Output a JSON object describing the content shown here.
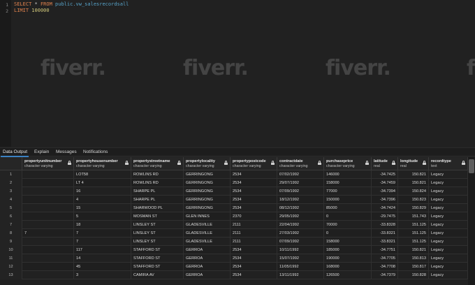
{
  "editor": {
    "line_numbers": [
      "1",
      "2"
    ],
    "line1": {
      "kw1": "SELECT",
      "star": " * ",
      "kw2": "FROM",
      "space": " ",
      "table": "public.vw_salesrecordsall"
    },
    "line2": {
      "kw": "LIMIT",
      "space": " ",
      "num": "100000"
    }
  },
  "watermark": "fiverr.",
  "tabs": [
    {
      "label": "Data Output",
      "active": true
    },
    {
      "label": "Explain",
      "active": false
    },
    {
      "label": "Messages",
      "active": false
    },
    {
      "label": "Notifications",
      "active": false
    }
  ],
  "columns": [
    {
      "name": "propertyunitnumber",
      "type": "character varying"
    },
    {
      "name": "propertyhousenumber",
      "type": "character varying"
    },
    {
      "name": "propertystreetname",
      "type": "character varying"
    },
    {
      "name": "propertylocality",
      "type": "character varying"
    },
    {
      "name": "propertypostcode",
      "type": "character varying"
    },
    {
      "name": "contractdate",
      "type": "character varying"
    },
    {
      "name": "purchaseprice",
      "type": "character varying"
    },
    {
      "name": "latitude",
      "type": "real"
    },
    {
      "name": "longitude",
      "type": "real"
    },
    {
      "name": "recordtype",
      "type": "text"
    }
  ],
  "rows": [
    [
      "1",
      "",
      "LOT58",
      "ROWLINS RD",
      "GERRINGONG",
      "2534",
      "07/02/1992",
      "146000",
      "-34.7425",
      "150.821",
      "Legacy"
    ],
    [
      "2",
      "",
      "LT 4",
      "ROWLINS RD",
      "GERRINGONG",
      "2534",
      "29/07/1992",
      "158000",
      "-34.7459",
      "150.821",
      "Legacy"
    ],
    [
      "3",
      "",
      "16",
      "SHARPE PL",
      "GERRINGONG",
      "2534",
      "07/09/1992",
      "77000",
      "-34.7394",
      "150.824",
      "Legacy"
    ],
    [
      "4",
      "",
      "4",
      "SHARPE PL",
      "GERRINGONG",
      "2534",
      "18/12/1992",
      "150000",
      "-34.7396",
      "150.823",
      "Legacy"
    ],
    [
      "5",
      "",
      "15",
      "SHARWOOD PL",
      "GERRINGONG",
      "2534",
      "08/12/1992",
      "85000",
      "-34.7424",
      "150.829",
      "Legacy"
    ],
    [
      "6",
      "",
      "5",
      "MOSMAN ST",
      "GLEN INNES",
      "2370",
      "29/05/1992",
      "0",
      "-29.7475",
      "151.743",
      "Legacy"
    ],
    [
      "7",
      "",
      "18",
      "LINSLEY ST",
      "GLADESVILLE",
      "2111",
      "22/04/1992",
      "70000",
      "-33.8328",
      "151.125",
      "Legacy"
    ],
    [
      "8",
      "7",
      "7",
      "LINSLEY ST",
      "GLADESVILLE",
      "2111",
      "27/03/1992",
      "0",
      "-33.8321",
      "151.125",
      "Legacy"
    ],
    [
      "9",
      "",
      "7",
      "LINSLEY ST",
      "GLADESVILLE",
      "2111",
      "07/09/1992",
      "158000",
      "-33.8321",
      "151.125",
      "Legacy"
    ],
    [
      "10",
      "",
      "117",
      "STAFFORD ST",
      "GERROA",
      "2534",
      "10/11/1992",
      "185000",
      "-34.7751",
      "150.821",
      "Legacy"
    ],
    [
      "11",
      "",
      "14",
      "STAFFORD ST",
      "GERROA",
      "2534",
      "15/07/1992",
      "190000",
      "-34.7705",
      "150.813",
      "Legacy"
    ],
    [
      "12",
      "",
      "45",
      "STAFFORD ST",
      "GERROA",
      "2534",
      "11/05/1992",
      "168000",
      "-34.7708",
      "150.817",
      "Legacy"
    ],
    [
      "13",
      "",
      "3",
      "CAMIRA AV",
      "GERROA",
      "2534",
      "13/11/1992",
      "126500",
      "-34.7379",
      "150.828",
      "Legacy"
    ]
  ]
}
